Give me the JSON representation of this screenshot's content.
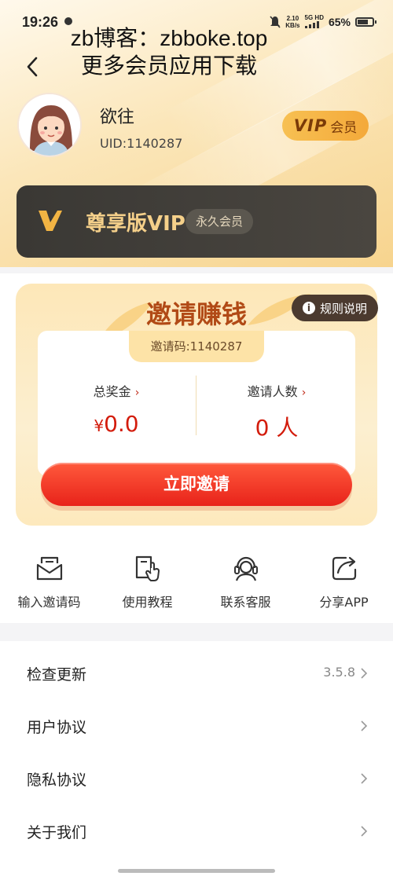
{
  "status_bar": {
    "time": "19:26",
    "speed_value": "2.10",
    "speed_unit": "KB/s",
    "network_top": "5G HD",
    "battery": "65%"
  },
  "watermark": {
    "line1": "zb博客：zbboke.top",
    "line2": "更多会员应用下载"
  },
  "profile": {
    "username": "欲往",
    "uid": "UID:1140287",
    "vip_badge_word": "VIP",
    "vip_badge_member": "会员"
  },
  "vip_card": {
    "title": "尊享版VIP",
    "tag": "永久会员",
    "accent": "#f5d08a"
  },
  "invite": {
    "title": "邀请赚钱",
    "rules_label": "规则说明",
    "invite_code": "邀请码:1140287",
    "stats": [
      {
        "label": "总奖金",
        "arrow": "›",
        "currency": "¥",
        "value": "0.0"
      },
      {
        "label": "邀请人数",
        "arrow": "›",
        "value": "0 人"
      }
    ],
    "button_label": "立即邀请",
    "button_color": "#e8221a"
  },
  "shortcuts": [
    {
      "label": "输入邀请码",
      "icon": "mail-icon"
    },
    {
      "label": "使用教程",
      "icon": "tutorial-book-icon"
    },
    {
      "label": "联系客服",
      "icon": "customer-service-icon"
    },
    {
      "label": "分享APP",
      "icon": "share-icon"
    }
  ],
  "menu": [
    {
      "label": "检查更新",
      "value": "3.5.8"
    },
    {
      "label": "用户协议",
      "value": ""
    },
    {
      "label": "隐私协议",
      "value": ""
    },
    {
      "label": "关于我们",
      "value": ""
    }
  ]
}
